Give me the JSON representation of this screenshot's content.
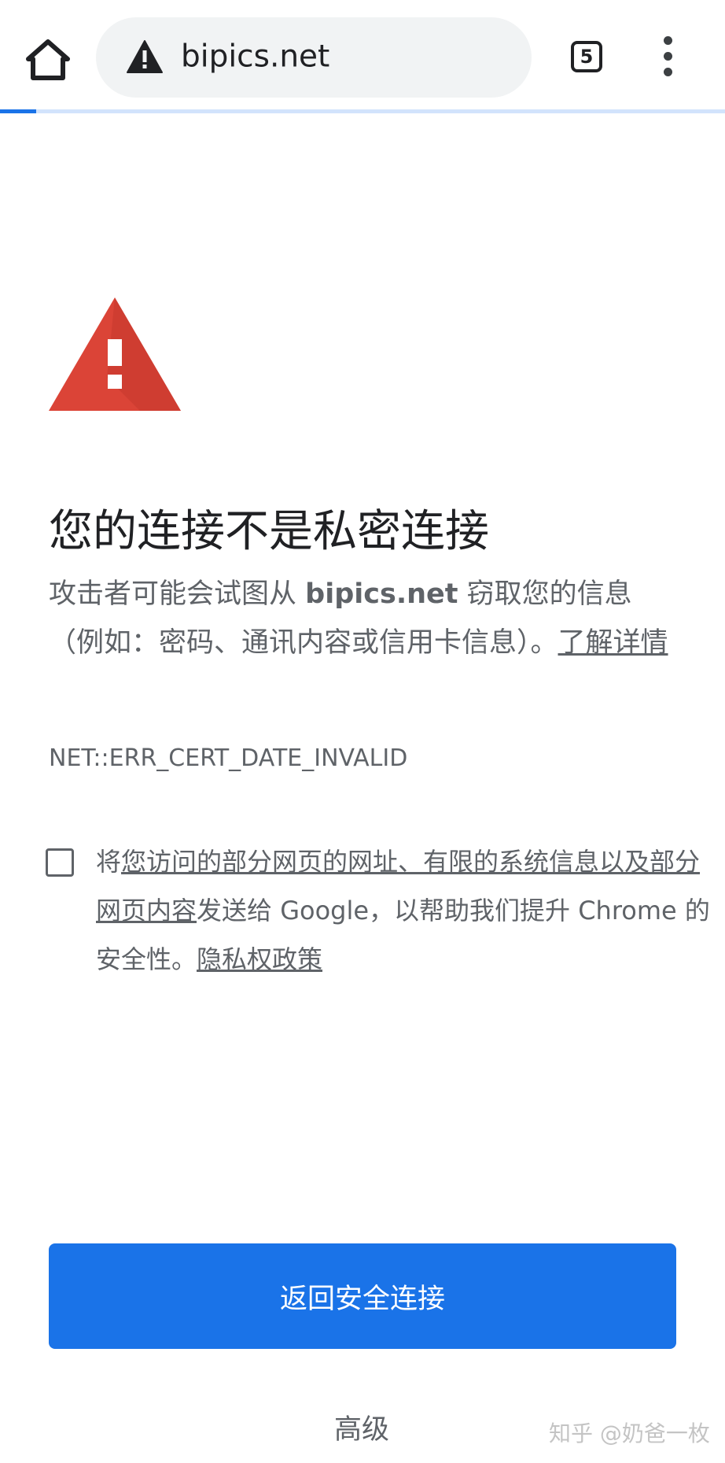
{
  "toolbar": {
    "url": "bipics.net",
    "tab_count": "5",
    "security_icon": "warning-triangle-icon",
    "home_icon": "home-icon",
    "menu_icon": "more-vertical-icon"
  },
  "page_load_progress": 0.05,
  "interstitial": {
    "heading": "您的连接不是私密连接",
    "explanation_prefix": "攻击者可能会试图从 ",
    "explanation_domain": "bipics.net",
    "explanation_suffix": " 窃取您的信息（例如：密码、通讯内容或信用卡信息）。",
    "learn_more_link": "了解详情",
    "error_code": "NET::ERR_CERT_DATE_INVALID",
    "opt_in": {
      "checked": false,
      "prefix": "将",
      "link_text": "您访问的部分网页的网址、有限的系统信息以及部分网页内容",
      "middle": "发送给 Google，以帮助我们提升 Chrome 的安全性。",
      "privacy_link": "隐私权政策"
    },
    "primary_button": "返回安全连接",
    "advanced_button": "高级"
  },
  "watermark": "知乎 @奶爸一枚",
  "colors": {
    "primary": "#1a73e8",
    "warning_red": "#db4437",
    "text_secondary": "#5f6368",
    "omnibox_bg": "#f1f3f4"
  }
}
